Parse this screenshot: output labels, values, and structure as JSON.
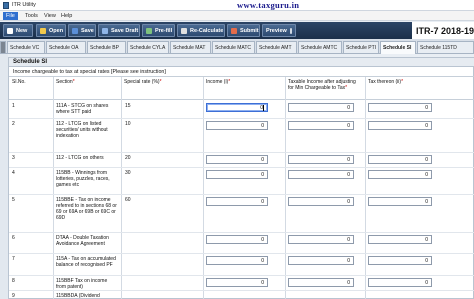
{
  "window": {
    "title": "ITR Utility",
    "watermark": "www.taxguru.in"
  },
  "menu": [
    "File",
    "Tools",
    "View",
    "Help"
  ],
  "toolbar": {
    "buttons": [
      {
        "label": "New",
        "icon": "new-icon"
      },
      {
        "label": "Open",
        "icon": "open-folder-icon"
      },
      {
        "label": "Save",
        "icon": "save-icon"
      },
      {
        "label": "Save Draft",
        "icon": "save-draft-icon"
      },
      {
        "label": "Pre-fill",
        "icon": "prefill-icon"
      },
      {
        "label": "Re-Calculate",
        "icon": "recalculate-icon"
      },
      {
        "label": "Submit",
        "icon": "submit-icon"
      },
      {
        "label": "Preview",
        "icon": "preview-icon"
      }
    ],
    "form_id": "ITR-7   2018-19"
  },
  "tabs": [
    "Schedule VC",
    "Schedule OA",
    "Schedule BP",
    "Schedule CYLA",
    "Schedule MAT",
    "Schedule MATC",
    "Schedule AMT",
    "Schedule AMTC",
    "Schedule PTI",
    "Schedule SI",
    "Schedule 115TD"
  ],
  "active_tab": "Schedule SI",
  "schedule": {
    "title": "Schedule SI",
    "subtitle": "Income chargeable to tax at special rates [Please see instruction]",
    "headers": {
      "sl": "Sl.No.",
      "section": "Section",
      "rate": "Special rate (%)",
      "income": "Income (i)",
      "taxable": "Taxable Income after adjusting for Min Chargeable to Tax",
      "tax": "Tax thereon (ii)"
    },
    "rows": [
      {
        "sl": "1",
        "section": "111A - STCG on shares where STT paid",
        "rate": "15",
        "income": "0",
        "taxable": "0",
        "tax": "0"
      },
      {
        "sl": "2",
        "section": "112 - LTCG on listed securities/ units without indexation",
        "rate": "10",
        "income": "0",
        "taxable": "0",
        "tax": "0"
      },
      {
        "sl": "3",
        "section": "112 - LTCG on others",
        "rate": "20",
        "income": "0",
        "taxable": "0",
        "tax": "0"
      },
      {
        "sl": "4",
        "section": "115BB - Winnings from lotteries, puzzles, races, games etc",
        "rate": "30",
        "income": "0",
        "taxable": "0",
        "tax": "0"
      },
      {
        "sl": "5",
        "section": "115BBE - Tax on income referred to in sections 68 or 69 or 69A or 69B or 69C or 69D",
        "rate": "60",
        "income": "0",
        "taxable": "0",
        "tax": "0"
      },
      {
        "sl": "6",
        "section": "DTAA - Double Taxation Avoidance Agreement",
        "rate": "",
        "income": "0",
        "taxable": "0",
        "tax": "0"
      },
      {
        "sl": "7",
        "section": "115A - Tax on accumulated balance of recognised PF",
        "rate": "",
        "income": "0",
        "taxable": "0",
        "tax": "0"
      },
      {
        "sl": "8",
        "section": "115BBF Tax on income from patent)",
        "rate": "",
        "income": "0",
        "taxable": "0",
        "tax": "0"
      },
      {
        "sl": "9",
        "section": "115BBDA (Dividend",
        "rate": "",
        "income": "0",
        "taxable": "0",
        "tax": "0"
      }
    ]
  }
}
